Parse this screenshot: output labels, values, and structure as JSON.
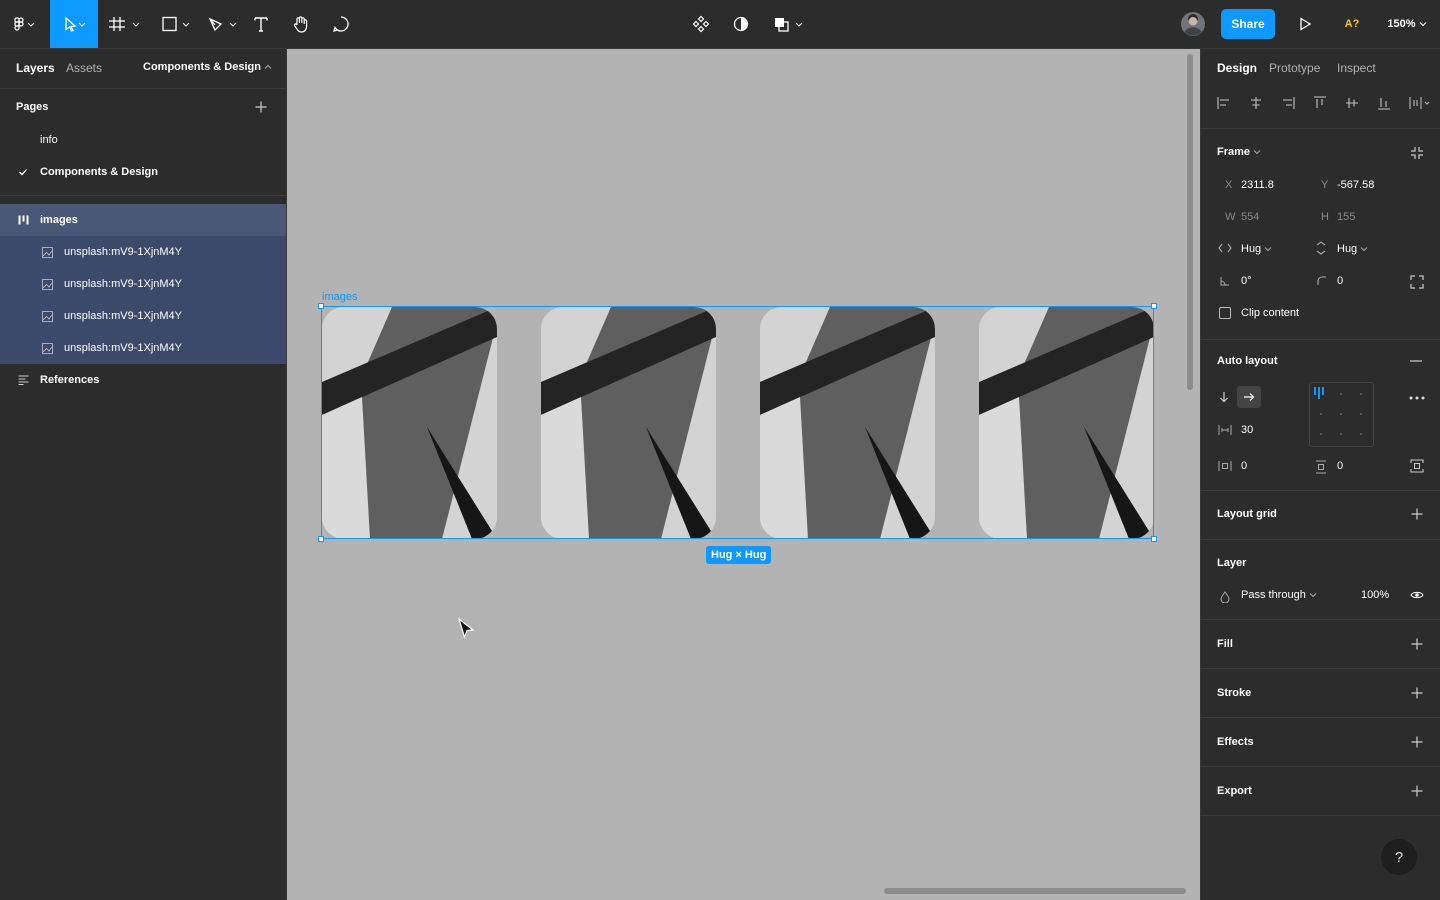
{
  "topbar": {
    "share_label": "Share",
    "missing_fonts": "A?",
    "zoom": "150%"
  },
  "left": {
    "tabs": {
      "layers": "Layers",
      "assets": "Assets",
      "page_selector": "Components & Design"
    },
    "pages_title": "Pages",
    "pages": [
      {
        "label": "info",
        "current": false
      },
      {
        "label": "Components & Design",
        "current": true
      }
    ],
    "layers": [
      {
        "label": "images",
        "type": "autolayout",
        "selected": true
      },
      {
        "label": "unsplash:mV9-1XjnM4Y",
        "type": "image"
      },
      {
        "label": "unsplash:mV9-1XjnM4Y",
        "type": "image"
      },
      {
        "label": "unsplash:mV9-1XjnM4Y",
        "type": "image"
      },
      {
        "label": "unsplash:mV9-1XjnM4Y",
        "type": "image"
      },
      {
        "label": "References",
        "type": "text"
      }
    ]
  },
  "canvas": {
    "frame_label": "images",
    "size_badge": "Hug × Hug",
    "image_count": 4,
    "selection_color": "#0d99ff"
  },
  "right": {
    "tabs": {
      "design": "Design",
      "prototype": "Prototype",
      "inspect": "Inspect"
    },
    "frame": {
      "title": "Frame",
      "x_label": "X",
      "x": "2311.8",
      "y_label": "Y",
      "y": "-567.58",
      "w_label": "W",
      "w": "554",
      "h_label": "H",
      "h": "155",
      "hsize": "Hug",
      "vsize": "Hug",
      "rotation": "0°",
      "radius": "0",
      "clip_content": "Clip content"
    },
    "auto_layout": {
      "title": "Auto layout",
      "gap": "30",
      "padding_h": "0",
      "padding_v": "0"
    },
    "layout_grid": "Layout grid",
    "layer": {
      "title": "Layer",
      "blend": "Pass through",
      "opacity": "100%"
    },
    "fill": "Fill",
    "stroke": "Stroke",
    "effects": "Effects",
    "export": "Export",
    "help": "?"
  }
}
